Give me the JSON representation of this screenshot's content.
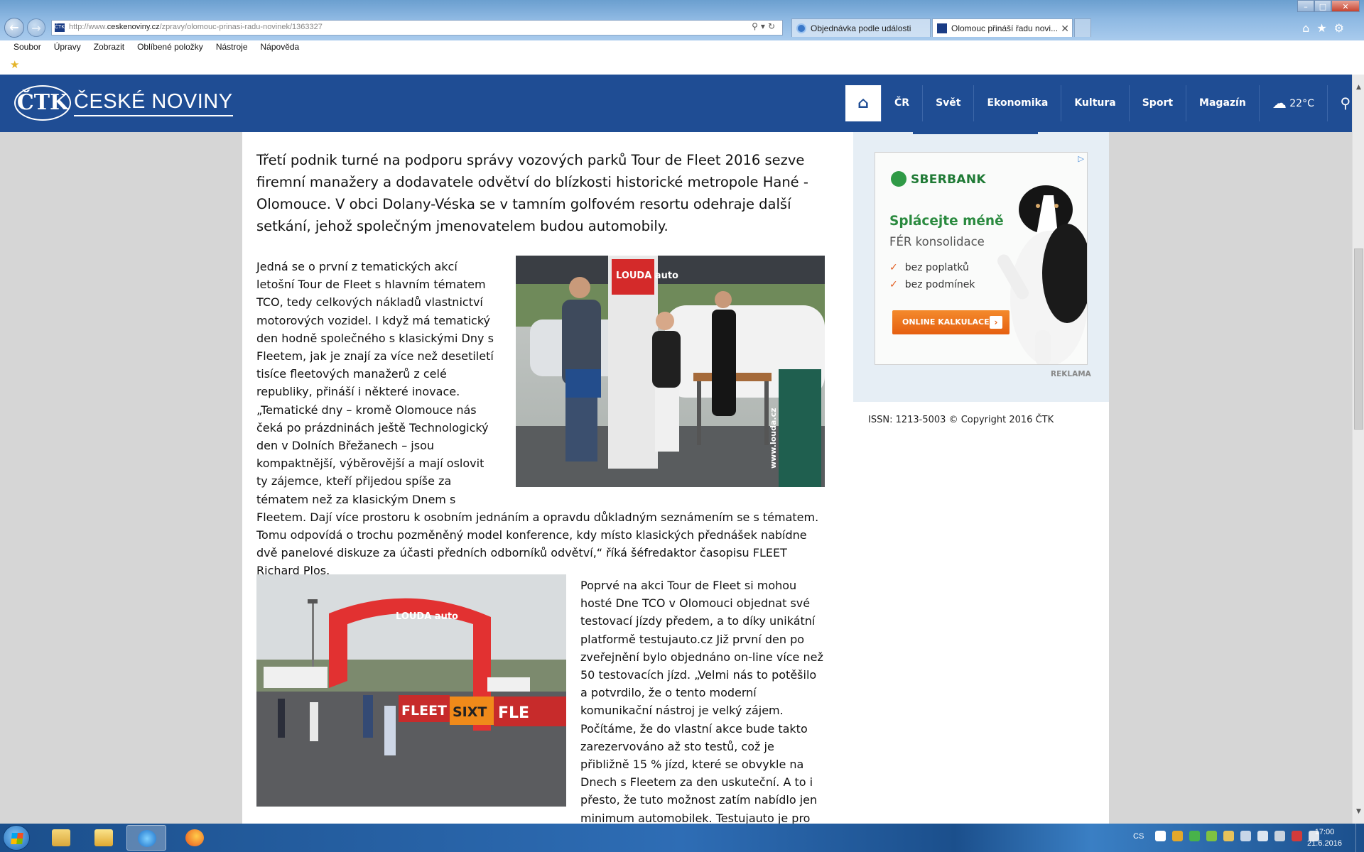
{
  "browser": {
    "address": {
      "prefix": "http://www.",
      "domain": "ceskenoviny.cz",
      "path": "/zpravy/olomouc-prinasi-radu-novinek/1363327"
    },
    "tabs": [
      {
        "label": "Objednávka podle události"
      },
      {
        "label": "Olomouc přináší řadu novi..."
      }
    ],
    "menu": [
      "Soubor",
      "Úpravy",
      "Zobrazit",
      "Oblíbené položky",
      "Nástroje",
      "Nápověda"
    ]
  },
  "site": {
    "logo_mark": "ČTK",
    "logo_text": "ČESKÉ NOVINY",
    "nav": [
      {
        "label": "ČR"
      },
      {
        "label": "Svět"
      },
      {
        "label": "Ekonomika"
      },
      {
        "label": "Kultura"
      },
      {
        "label": "Sport"
      },
      {
        "label": "Magazín"
      }
    ],
    "weather": "22°C",
    "brand_color": "#1f4d94"
  },
  "article": {
    "lead": "Třetí podnik turné na podporu správy vozových parků Tour de Fleet 2016 sezve firemní manažery a dodavatele odvětví do blízkosti historické metropole Hané - Olomouce. V obci Dolany-Véska se v tamním golfovém resortu odehraje další setkání, jehož společným jmenovatelem budou automobily.",
    "para1": "Jedná se o první z tematických akcí letošní Tour de Fleet s hlavním tématem TCO, tedy celkových nákladů vlastnictví motorových vozidel. I když má tematický den hodně společného s klasickými Dny s Fleetem, jak je znají za více než desetiletí tisíce fleetových manažerů z celé republiky, přináší i některé inovace. „Tematické dny – kromě Olomouce nás čeká po prázdninách ještě Technologický den v Dolních Břežanech – jsou kompaktnější, výběrovější a mají oslovit ty zájemce, kteří přijedou spíše za tématem než za klasickým Dnem s Fleetem. Dají více prostoru k osobním jednáním a opravdu důkladným seznámením se s tématem. Tomu odpovídá o trochu pozměněný model konference, kdy místo klasických přednášek nabídne dvě panelové diskuze za účasti předních odborníků odvětví,“ říká šéfredaktor časopisu FLEET Richard Plos.",
    "para2": "Poprvé na akci Tour de Fleet si mohou hosté Dne TCO v Olomouci objednat své testovací jízdy předem, a to díky unikátní platformě testujauto.cz Již první den po zveřejnění bylo objednáno on-line více než 50 testovacích jízd. „Velmi nás to potěšilo a potvrdilo, že o tento moderní komunikační nástroj je velký zájem. Počítáme, že do vlastní akce bude takto zarezervováno až sto testů, což je přibližně 15 % jízd, které se obvykle na Dnech s Fleetem za den uskuteční. A to i přesto, že tuto možnost zatím nabídlo jen minimum automobilek. Testujauto je pro aktivní prodejce, kteří si váží času svých",
    "photo1": {
      "banner_text": "LOUDA auto",
      "sign_url": "www.louda.cz"
    },
    "photo2": {
      "arch_text": "LOUDA auto",
      "banners": [
        "FLEET",
        "SIXT",
        "FLE"
      ]
    }
  },
  "sidebar": {
    "ad": {
      "bank": "SBERBANK",
      "headline": "Splácejte méně",
      "subheadline": "FÉR konsolidace",
      "checks": [
        "bez poplatků",
        "bez podmínek"
      ],
      "button": "ONLINE KALKULACE",
      "label": "REKLAMA"
    },
    "issn": "ISSN: 1213-5003 © Copyright 2016 ČTK"
  },
  "taskbar": {
    "lang": "CS",
    "time": "17:00",
    "date": "21.6.2016"
  }
}
